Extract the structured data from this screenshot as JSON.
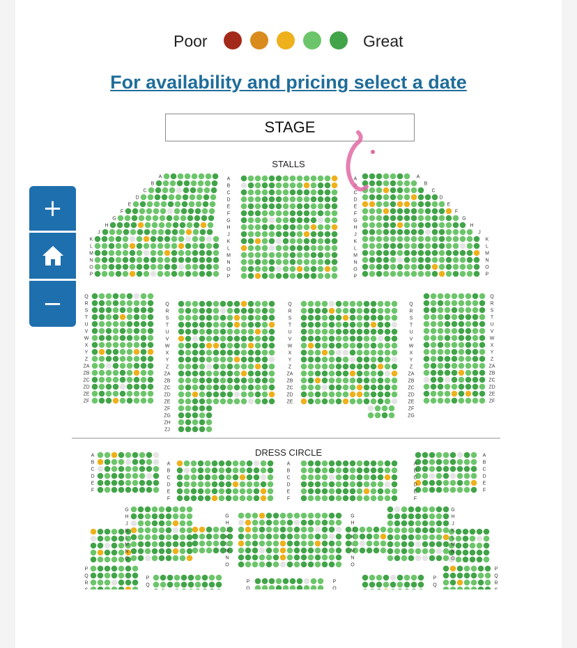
{
  "legend": {
    "poor_label": "Poor",
    "great_label": "Great",
    "scale_colors": [
      "#a3291b",
      "#d98b1e",
      "#eeb01b",
      "#6cc56a",
      "#41a448"
    ]
  },
  "date_link": "For availability and pricing select a date",
  "stage_label": "STAGE",
  "sections": {
    "stalls": "STALLS",
    "dress_circle": "DRESS CIRCLE"
  },
  "rows": {
    "stalls_front_left": [
      "A",
      "B",
      "C",
      "D",
      "E",
      "F",
      "G",
      "H",
      "J",
      "K",
      "L",
      "M",
      "N",
      "O",
      "P"
    ],
    "stalls_front_center": [
      "A",
      "B",
      "C",
      "D",
      "E",
      "F",
      "G",
      "H",
      "J",
      "K",
      "L",
      "M",
      "N",
      "O",
      "P"
    ],
    "stalls_rear": [
      "Q",
      "R",
      "S",
      "T",
      "U",
      "V",
      "W",
      "X",
      "Y",
      "Z",
      "ZA",
      "ZB",
      "ZC",
      "ZD",
      "ZE",
      "ZF",
      "ZG",
      "ZH",
      "ZJ"
    ],
    "dress_front": [
      "A",
      "B",
      "C",
      "D",
      "E",
      "F"
    ],
    "dress_mid": [
      "G",
      "H",
      "J",
      "K",
      "L",
      "M",
      "N",
      "O"
    ],
    "dress_rear": [
      "P",
      "Q",
      "R",
      "S"
    ]
  },
  "controls": {
    "zoom_in_icon": "plus-icon",
    "home_icon": "home-icon",
    "zoom_out_icon": "minus-icon"
  },
  "seat_colors": {
    "great": "#41a448",
    "good": "#6cc56a",
    "ok": "#eeb01b",
    "fair": "#d98b1e",
    "poor": "#a3291b",
    "gap": "#e4e4e4"
  }
}
